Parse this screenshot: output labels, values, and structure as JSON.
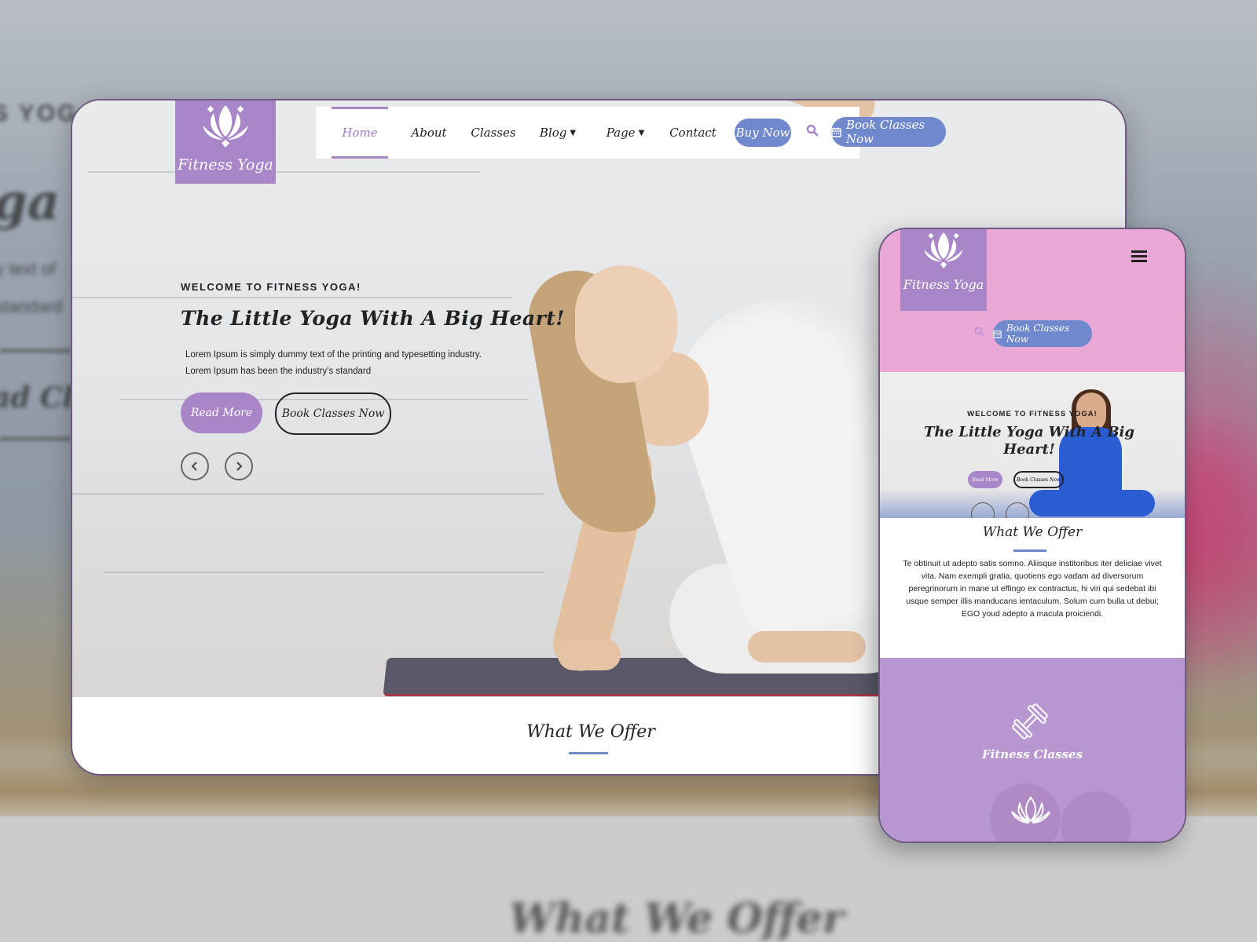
{
  "background": {
    "blurred_texts": [
      "S YOG",
      "ga",
      "y text of",
      "standard",
      "ad Cl",
      "What We Offer"
    ]
  },
  "desktop": {
    "logo": {
      "icon": "lotus-icon",
      "text": "Fitness Yoga"
    },
    "nav": {
      "items": [
        {
          "label": "Home",
          "active": true
        },
        {
          "label": "About"
        },
        {
          "label": "Classes"
        },
        {
          "label": "Blog",
          "dropdown": true
        },
        {
          "label": "Page",
          "dropdown": true
        },
        {
          "label": "Contact"
        }
      ],
      "buy_now": "Buy Now",
      "search_icon": "search-icon",
      "book_classes": "Book Classes Now",
      "book_icon": "calendar-icon"
    },
    "hero": {
      "welcome": "WELCOME TO FITNESS YOGA!",
      "title": "The Little Yoga With A Big Heart!",
      "body_line1": "Lorem Ipsum is simply dummy text of the printing and typesetting industry.",
      "body_line2": "Lorem Ipsum has been the industry's standard",
      "read_more": "Read More",
      "book_classes": "Book Classes Now",
      "prev": "‹",
      "next": "›"
    },
    "offer": {
      "title": "What We Offer"
    }
  },
  "mobile": {
    "logo": {
      "icon": "lotus-icon",
      "text": "Fitness Yoga"
    },
    "menu_icon": "hamburger-icon",
    "book_classes": "Book Classes Now",
    "hero": {
      "welcome": "WELCOME TO FITNESS YOGA!",
      "title": "The Little Yoga With A Big Heart!",
      "read_more": "Read More",
      "book_classes": "Book Classes Now"
    },
    "offer": {
      "title": "What We Offer",
      "body": "Te obtinuit ut adepto satis somno. Aliisque institoribus iter deliciae vivet vita. Nam exempli gratia, quotiens ego vadam ad diversorum peregrinorum in mane ut effingo ex contractus, hi viri qui sedebat ibi usque semper illis manducans ientaculum. Solum cum bulla ut debui; EGO youd adepto a macula proiciendi."
    },
    "services": [
      {
        "icon": "dumbbell-icon",
        "title": "Fitness Classes"
      },
      {
        "icon": "lotus-icon",
        "title": ""
      }
    ]
  },
  "colors": {
    "brand_purple": "#a886c8",
    "button_blue": "#7088cc",
    "mobile_header_pink": "#e9a8d6",
    "services_purple": "#b896d0"
  }
}
